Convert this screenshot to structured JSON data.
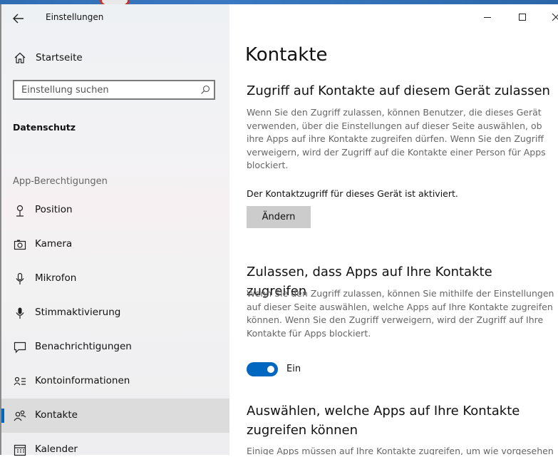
{
  "window": {
    "title": "Einstellungen",
    "controls": {
      "minimize": "minimize-icon",
      "maximize": "maximize-icon",
      "close": "close-icon"
    }
  },
  "sidebar": {
    "home_label": "Startseite",
    "search_placeholder": "Einstellung suchen",
    "section_title": "Datenschutz",
    "group_label": "App-Berechtigungen",
    "items": [
      {
        "label": "Position",
        "icon": "location-icon"
      },
      {
        "label": "Kamera",
        "icon": "camera-icon"
      },
      {
        "label": "Mikrofon",
        "icon": "microphone-icon"
      },
      {
        "label": "Stimmaktivierung",
        "icon": "voice-activation-icon"
      },
      {
        "label": "Benachrichtigungen",
        "icon": "notifications-icon"
      },
      {
        "label": "Kontoinformationen",
        "icon": "account-info-icon"
      },
      {
        "label": "Kontakte",
        "icon": "contacts-icon",
        "selected": true
      },
      {
        "label": "Kalender",
        "icon": "calendar-icon"
      }
    ]
  },
  "main": {
    "title": "Kontakte",
    "device_section": {
      "heading": "Zugriff auf Kontakte auf diesem Gerät zulassen",
      "description": "Wenn Sie den Zugriff zulassen, können Benutzer, die dieses Gerät verwenden, über die Einstellungen auf dieser Seite auswählen, ob ihre Apps auf ihre Kontakte zugreifen dürfen. Wenn Sie den Zugriff verweigern, wird der Zugriff auf die Kontakte einer Person für Apps blockiert.",
      "status": "Der Kontaktzugriff für dieses Gerät ist aktiviert.",
      "change_button": "Ändern"
    },
    "apps_section": {
      "heading": "Zulassen, dass Apps auf Ihre Kontakte zugreifen",
      "description": "Wenn Sie den Zugriff zulassen, können Sie mithilfe der Einstellungen auf dieser Seite auswählen, welche Apps auf Ihre Kontakte zugreifen können. Wenn Sie den Zugriff verweigern, wird der Zugriff auf Ihre Kontakte für Apps blockiert.",
      "toggle_on": true,
      "toggle_label": "Ein"
    },
    "choose_section": {
      "heading": "Auswählen, welche Apps auf Ihre Kontakte zugreifen können",
      "description": "Einige Apps müssen auf Ihre Kontakte zugreifen, um wie vorgesehen"
    }
  },
  "colors": {
    "accent": "#0067c0",
    "selected_bg": "#dcdcdc",
    "button_bg": "#cccccc"
  }
}
